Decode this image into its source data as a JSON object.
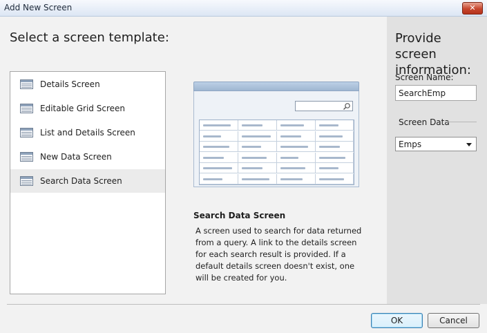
{
  "window": {
    "title": "Add New Screen",
    "close_glyph": "✕"
  },
  "left": {
    "heading": "Select a screen template:",
    "templates": [
      {
        "label": "Details Screen",
        "icon": "details-screen-icon",
        "selected": false
      },
      {
        "label": "Editable Grid Screen",
        "icon": "editable-grid-icon",
        "selected": false
      },
      {
        "label": "List and Details Screen",
        "icon": "list-details-icon",
        "selected": false
      },
      {
        "label": "New Data Screen",
        "icon": "new-data-icon",
        "selected": false
      },
      {
        "label": "Search Data Screen",
        "icon": "search-data-icon",
        "selected": true
      }
    ]
  },
  "preview": {
    "title": "Search Data Screen",
    "description": "A screen used to search for data returned from a query.  A link to the details screen for each search result is provided.  If a default details screen doesn't exist, one will be created for you."
  },
  "right": {
    "heading": "Provide screen information:",
    "screen_name_label": "Screen Name:",
    "screen_name_value": "SearchEmp",
    "screen_data_label": "Screen Data",
    "screen_data_value": "Emps"
  },
  "buttons": {
    "ok": "OK",
    "cancel": "Cancel"
  },
  "colors": {
    "selection": "#ebebeb",
    "right_pane": "#e1e1e1",
    "preview_header": "#bcd0e6"
  }
}
